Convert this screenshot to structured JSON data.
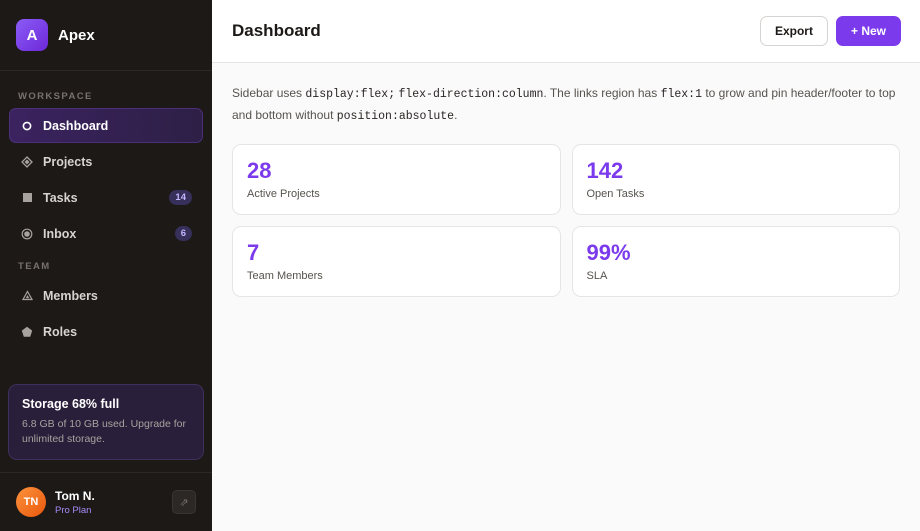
{
  "brand": {
    "logo_letter": "A",
    "name": "Apex",
    "accent": "#7c3aed"
  },
  "sidebar": {
    "sections": [
      {
        "label": "WORKSPACE"
      },
      {
        "label": "TEAM"
      }
    ],
    "items": [
      {
        "label": "Dashboard",
        "icon": "circle-icon",
        "badge": ""
      },
      {
        "label": "Projects",
        "icon": "diamond-icon",
        "badge": ""
      },
      {
        "label": "Tasks",
        "icon": "square-icon",
        "badge": "14"
      },
      {
        "label": "Inbox",
        "icon": "radio-icon",
        "badge": "6"
      },
      {
        "label": "Members",
        "icon": "triangle-icon",
        "badge": ""
      },
      {
        "label": "Roles",
        "icon": "pentagon-icon",
        "badge": ""
      }
    ],
    "storage": {
      "title": "Storage 68% full",
      "text": "6.8 GB of 10 GB used. Upgrade for unlimited storage.",
      "percent": 68
    },
    "user": {
      "initials": "TN",
      "name": "Tom N.",
      "plan": "Pro Plan",
      "logout_glyph": "⇗"
    }
  },
  "header": {
    "title": "Dashboard",
    "export_label": "Export",
    "new_label": "+ New"
  },
  "description": {
    "p1": "Sidebar uses ",
    "c1": "display:flex;",
    "p2": " ",
    "c2": "flex-direction:column",
    "p3": ". The links region has ",
    "c3": "flex:1",
    "p4": " to grow and pin header/footer to top and bottom without ",
    "c4": "position:absolute",
    "p5": "."
  },
  "stats": [
    {
      "value": "28",
      "label": "Active Projects"
    },
    {
      "value": "142",
      "label": "Open Tasks"
    },
    {
      "value": "7",
      "label": "Team Members"
    },
    {
      "value": "99%",
      "label": "SLA"
    }
  ]
}
